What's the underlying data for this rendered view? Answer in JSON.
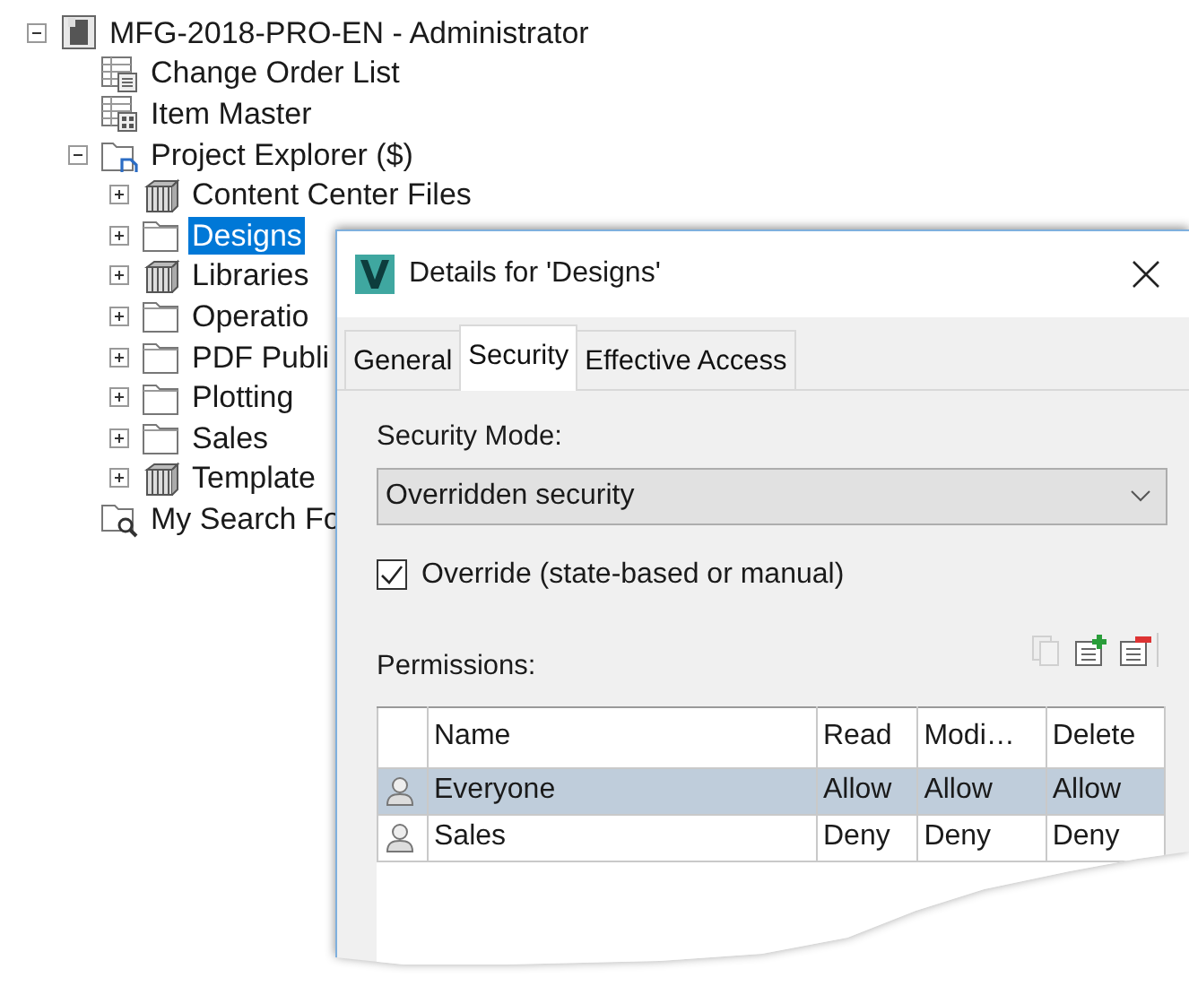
{
  "tree": [
    {
      "label": "MFG-2018-PRO-EN - Administrator",
      "kind": "vault",
      "expanded": true,
      "selected": false,
      "children": [
        {
          "label": "Change Order List",
          "kind": "list",
          "selected": false
        },
        {
          "label": "Item Master",
          "kind": "items",
          "selected": false
        },
        {
          "label": "Project Explorer ($)",
          "kind": "project",
          "expanded": true,
          "selected": false,
          "children": [
            {
              "label": "Content Center Files",
              "kind": "library",
              "expanded": false,
              "selected": false
            },
            {
              "label": "Designs",
              "kind": "folder",
              "expanded": false,
              "selected": true
            },
            {
              "label": "Libraries",
              "kind": "library",
              "expanded": false,
              "selected": false
            },
            {
              "label": "Operatio",
              "kind": "folder",
              "expanded": false,
              "selected": false
            },
            {
              "label": "PDF Publi",
              "kind": "folder",
              "expanded": false,
              "selected": false
            },
            {
              "label": "Plotting",
              "kind": "folder",
              "expanded": false,
              "selected": false
            },
            {
              "label": "Sales",
              "kind": "folder",
              "expanded": false,
              "selected": false
            },
            {
              "label": "Template",
              "kind": "library",
              "expanded": false,
              "selected": false
            }
          ]
        },
        {
          "label": "My Search Fo",
          "kind": "search",
          "selected": false
        }
      ]
    }
  ],
  "dialog": {
    "title": "Details for 'Designs'",
    "tabs": [
      {
        "label": "General",
        "selected": false
      },
      {
        "label": "Security",
        "selected": true
      },
      {
        "label": "Effective Access",
        "selected": false
      }
    ],
    "security_mode": {
      "label": "Security Mode:",
      "value": "Overridden security"
    },
    "override": {
      "label": "Override (state-based or manual)",
      "checked": true
    },
    "permissions": {
      "label": "Permissions:",
      "toolbar": [
        {
          "kind": "copy",
          "disabled": true
        },
        {
          "kind": "add",
          "disabled": false
        },
        {
          "kind": "remove",
          "disabled": false
        }
      ],
      "columns": [
        "Name",
        "Read",
        "Modi…",
        "Delete"
      ],
      "rows": [
        {
          "cells": [
            "Everyone",
            "Allow",
            "Allow",
            "Allow"
          ],
          "selected": true
        },
        {
          "cells": [
            "Sales",
            "Deny",
            "Deny",
            "Deny"
          ],
          "selected": false
        }
      ]
    }
  }
}
